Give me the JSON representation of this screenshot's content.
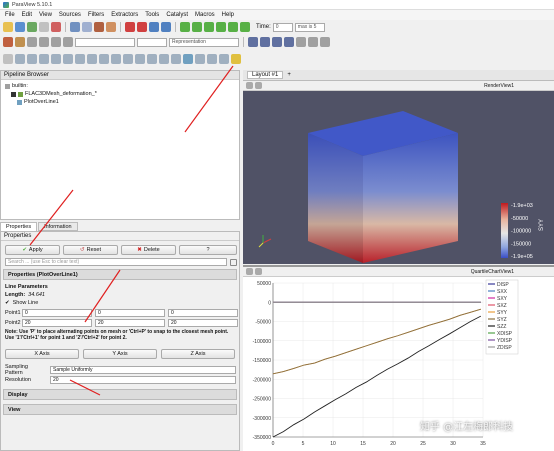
{
  "window": {
    "title": "ParaView 5.10.1"
  },
  "menu": [
    "File",
    "Edit",
    "View",
    "Sources",
    "Filters",
    "Extractors",
    "Tools",
    "Catalyst",
    "Macros",
    "Help"
  ],
  "toolbar": {
    "time_label": "Time:",
    "time_value": "0",
    "time_max": "max is 5",
    "representation": "Representation"
  },
  "pipeline": {
    "title": "Pipeline Browser",
    "items": [
      "builtin:",
      "FLAC3DMesh_deformation_*",
      "PlotOverLine1"
    ]
  },
  "tabs": [
    "Properties",
    "Information"
  ],
  "properties": {
    "header": "Properties",
    "apply": "Apply",
    "reset": "Reset",
    "delete": "Delete",
    "help": "?",
    "search_placeholder": "Search ... (use Esc to clear text)",
    "section_main": "Properties (PlotOverLine1)",
    "line_params": "Line Parameters",
    "length_label": "Length:",
    "length_value": "34.641",
    "show_line": "Show Line",
    "point1_label": "Point1",
    "point1": [
      "0",
      "0",
      "0"
    ],
    "point2_label": "Point2",
    "point2": [
      "20",
      "20",
      "20"
    ],
    "note": "Note: Use 'P' to place alternating points on mesh or 'Ctrl+P' to snap to the closest mesh point. Use '1'/'Ctrl+1' for point 1 and '2'/'Ctrl+2' for point 2.",
    "axis_buttons": [
      "X Axis",
      "Y Axis",
      "Z Axis"
    ],
    "sampling_label": "Sampling Pattern",
    "sampling_value": "Sample Uniformly",
    "resolution_label": "Resolution",
    "resolution_value": "20",
    "display_section": "Display",
    "view_section": "View"
  },
  "layout": {
    "tab": "Layout #1",
    "render_view": "RenderView1",
    "chart_view": "QuartileChartView1"
  },
  "colorbar": {
    "title": "SYY",
    "ticks": [
      "-1.9e+03",
      "-50000",
      "-100000",
      "-150000",
      "-1.9e+05"
    ],
    "colors": [
      "#c01a1f",
      "#e8b39e",
      "#e6e6e6",
      "#8fa6e0",
      "#3a4ec4"
    ]
  },
  "watermark": "知乎 @江左梅郎科技",
  "chart_data": {
    "type": "line",
    "x": [
      0,
      1.73,
      3.46,
      5.2,
      6.93,
      8.66,
      10.39,
      12.12,
      13.86,
      15.59,
      17.32,
      19.05,
      20.78,
      22.52,
      24.25,
      25.98,
      27.71,
      29.44,
      31.18,
      32.91,
      34.64
    ],
    "xticks": [
      0,
      5,
      10,
      15,
      20,
      25,
      30,
      35
    ],
    "yticks": [
      50000,
      0,
      -50000,
      -100000,
      -150000,
      -200000,
      -250000,
      -300000,
      -350000
    ],
    "ytick_labels": [
      "50000",
      "0",
      "-50000",
      "-100000",
      "-150000",
      "-200000",
      "-250000",
      "-300000",
      "-350000"
    ],
    "xtick_labels": [
      "0",
      "5",
      "10",
      "15",
      "20",
      "25",
      "30",
      "35"
    ],
    "xlim": [
      0,
      35
    ],
    "ylim": [
      -350000,
      50000
    ],
    "series": [
      {
        "name": "DISP",
        "color": "#3a3a9a",
        "values": [
          0,
          0,
          0,
          0,
          0,
          0,
          0,
          0,
          0,
          0,
          0,
          0,
          0,
          0,
          0,
          0,
          0,
          0,
          0,
          0,
          0
        ]
      },
      {
        "name": "SXX",
        "color": "#4a7fbf",
        "values": [
          0,
          0,
          0,
          0,
          0,
          0,
          0,
          0,
          0,
          0,
          0,
          0,
          0,
          0,
          0,
          0,
          0,
          0,
          0,
          0,
          0
        ]
      },
      {
        "name": "SXY",
        "color": "#d02aa0",
        "values": [
          0,
          0,
          0,
          0,
          0,
          0,
          0,
          0,
          0,
          0,
          0,
          0,
          0,
          0,
          0,
          0,
          0,
          0,
          0,
          0,
          0
        ]
      },
      {
        "name": "SXZ",
        "color": "#e0556a",
        "values": [
          0,
          0,
          0,
          0,
          0,
          0,
          0,
          0,
          0,
          0,
          0,
          0,
          0,
          0,
          0,
          0,
          0,
          0,
          0,
          0,
          0
        ]
      },
      {
        "name": "SYY",
        "color": "#e8a040",
        "values": [
          -186000,
          -180000,
          -172000,
          -163000,
          -158000,
          -148000,
          -140000,
          -131000,
          -122000,
          -113000,
          -104000,
          -95000,
          -87000,
          -78000,
          -69000,
          -60000,
          -52000,
          -44000,
          -34000,
          -26000,
          -18000
        ]
      },
      {
        "name": "SYZ",
        "color": "#8a6f40",
        "values": [
          -186000,
          -180000,
          -172000,
          -163000,
          -158000,
          -148000,
          -140000,
          -131000,
          -122000,
          -113000,
          -104000,
          -95000,
          -87000,
          -78000,
          -69000,
          -60000,
          -52000,
          -44000,
          -34000,
          -26000,
          -18000
        ]
      },
      {
        "name": "SZZ",
        "color": "#222222",
        "values": [
          -350000,
          -336000,
          -318000,
          -303000,
          -285000,
          -269000,
          -253000,
          -238000,
          -221000,
          -207000,
          -190000,
          -174000,
          -160000,
          -145000,
          -128000,
          -113000,
          -97000,
          -82000,
          -66000,
          -50000,
          -36000
        ]
      },
      {
        "name": "XDISP",
        "color": "#52a24a",
        "values": [
          0,
          0,
          0,
          0,
          0,
          0,
          0,
          0,
          0,
          0,
          0,
          0,
          0,
          0,
          0,
          0,
          0,
          0,
          0,
          0,
          0
        ]
      },
      {
        "name": "YDISP",
        "color": "#7a50a0",
        "values": [
          0,
          0,
          0,
          0,
          0,
          0,
          0,
          0,
          0,
          0,
          0,
          0,
          0,
          0,
          0,
          0,
          0,
          0,
          0,
          0,
          0
        ]
      },
      {
        "name": "ZDISP",
        "color": "#9a9a9a",
        "values": [
          0,
          0,
          0,
          0,
          0,
          0,
          0,
          0,
          0,
          0,
          0,
          0,
          0,
          0,
          0,
          0,
          0,
          0,
          0,
          0,
          0
        ]
      }
    ]
  }
}
